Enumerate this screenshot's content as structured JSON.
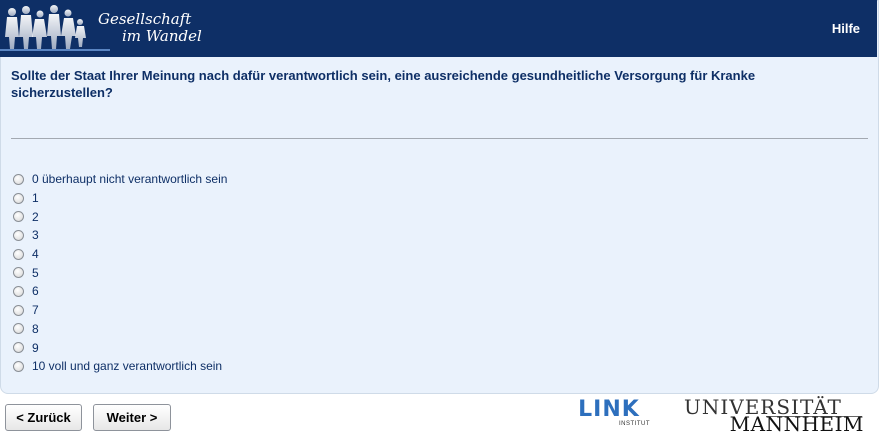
{
  "header": {
    "logo_line1": "Gesellschaft",
    "logo_line2": "im Wandel",
    "help_label": "Hilfe"
  },
  "question": {
    "text": "Sollte der Staat Ihrer Meinung nach dafür verantwortlich sein, eine ausreichende gesundheitliche Versorgung für Kranke sicherzustellen?"
  },
  "options": [
    "0 überhaupt nicht verantwortlich sein",
    "1",
    "2",
    "3",
    "4",
    "5",
    "6",
    "7",
    "8",
    "9",
    "10 voll und ganz verantwortlich sein"
  ],
  "nav": {
    "back_label": "< Zurück",
    "next_label": "Weiter >"
  },
  "footer": {
    "link_logo": "LINK",
    "link_sub": "INSTITUT",
    "uni_line1": "UNIVERSITÄT",
    "uni_line2": "MANNHEIM"
  },
  "colors": {
    "header_bg": "#0e2f66",
    "panel_bg": "#eaf2fc",
    "text": "#0e2f66"
  }
}
